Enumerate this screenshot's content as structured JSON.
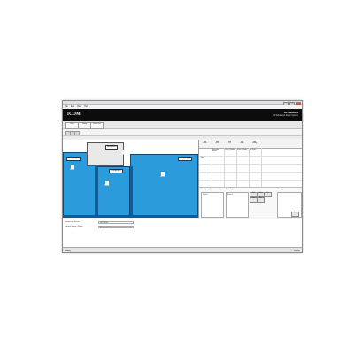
{
  "menu": [
    "File",
    "Edit",
    "View",
    "Help"
  ],
  "banner": {
    "logo": "ICOM",
    "product": "RP-SERIES",
    "subtitle": "IP Advanced Radio System"
  },
  "tabs": [
    "Zone",
    "Group",
    "Radio List"
  ],
  "map": {
    "zones": [
      "Shopping 1",
      "Shopping 2",
      "Shopping 3"
    ],
    "callout": "Reception",
    "radios": [
      "Radio",
      "Radio",
      "Radio",
      "Radio"
    ]
  },
  "grid": {
    "headers": [
      "Status",
      "Group",
      "Call",
      "Radio",
      "Setting"
    ],
    "cells": [
      "Reception Radio",
      "Shop 1 Radio",
      "Shop 2 Radio",
      "All Radio",
      "Idle"
    ]
  },
  "properties": {
    "headers": [
      "Group",
      "Member",
      "Setting"
    ],
    "fields": [
      "Radio 1",
      "Radio 2"
    ],
    "buttons": [
      "Add",
      "Delete",
      "Up",
      "Down",
      "Edit",
      "Apply"
    ]
  },
  "log": {
    "rows": [
      {
        "label": "Connected Server",
        "value": "192.168.0.1"
      },
      {
        "label": "Current Group / Radio",
        "value": "Shopping 1"
      }
    ]
  },
  "status": {
    "left": "Ready",
    "right": "Online"
  },
  "colors": {
    "zone": "#2b9bdc",
    "zone_dark": "#0f5d98",
    "banner": "#0c0c0c"
  }
}
